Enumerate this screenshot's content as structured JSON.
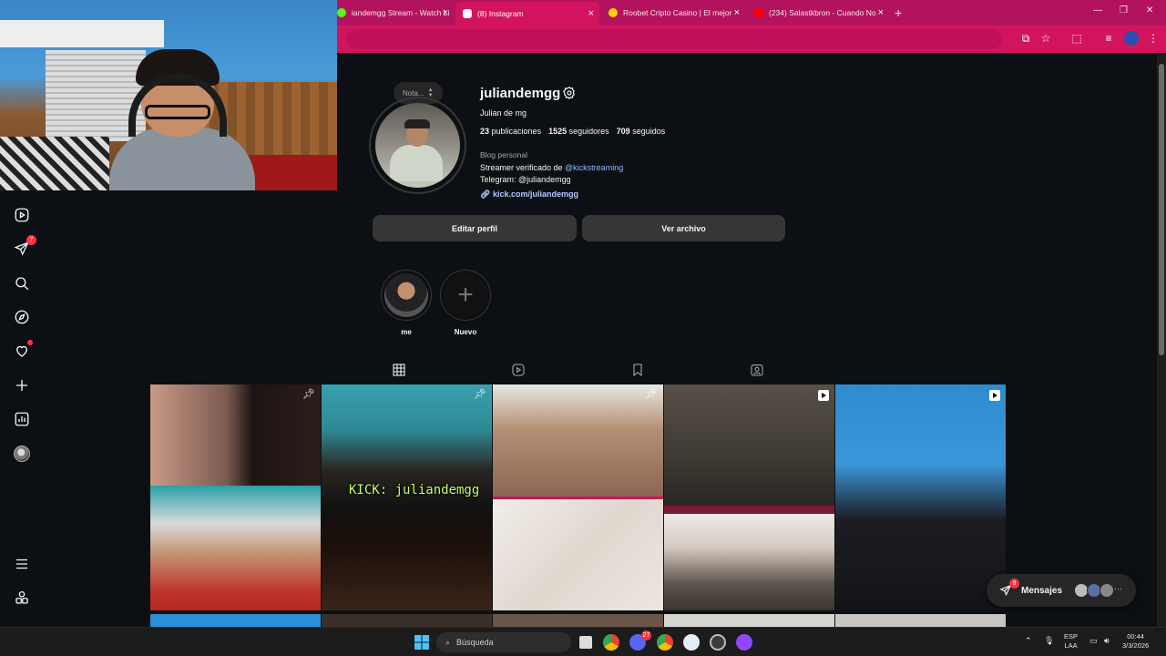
{
  "browser": {
    "tabs": [
      {
        "title": "iandemgg Stream - Watch Li",
        "favicon_color": "#53fc18"
      },
      {
        "title": "(8) Instagram",
        "favicon_color": "#ffffff"
      },
      {
        "title": "Roobet Cripto Casino | El mejor",
        "favicon_color": "#ffd400"
      },
      {
        "title": "(234) Salastkbron - Cuando No",
        "favicon_color": "#ff0000"
      }
    ],
    "new_tab": "+",
    "close": "×",
    "min": "—",
    "max": "❐",
    "winclose": "✕"
  },
  "profile": {
    "username": "juliandemgg",
    "full_name": "Julian de mg",
    "posts_count": "23",
    "posts_label": "publicaciones",
    "followers_count": "1525",
    "followers_label": "seguidores",
    "following_count": "709",
    "following_label": "seguidos",
    "category": "Blog personal",
    "bio_line1_prefix": "Streamer verificado de ",
    "bio_mention": "@kickstreaming",
    "bio_line2": "Telegram: @juliandemgg",
    "link": "kick.com/juliandemgg",
    "note": "Nota..."
  },
  "buttons": {
    "edit_profile": "Editar perfil",
    "view_archive": "Ver archivo"
  },
  "highlights": [
    {
      "label": "me"
    },
    {
      "label": "Nuevo"
    }
  ],
  "rail": {
    "notifications_badge": "7"
  },
  "grid": {
    "kick_overlay": "KICK: juliandemgg"
  },
  "messages": {
    "label": "Mensajes",
    "badge": "8",
    "more": "···"
  },
  "taskbar": {
    "search_placeholder": "Búsqueda",
    "lang_line1": "ESP",
    "lang_line2": "LAA",
    "time": "00:44",
    "date": "3/3/2026",
    "discord_badge": "27"
  },
  "colors": {
    "browser_accent": "#d2145f",
    "ig_bg": "#0c1014",
    "link": "#b5c9ff",
    "badge_red": "#ff3040"
  }
}
